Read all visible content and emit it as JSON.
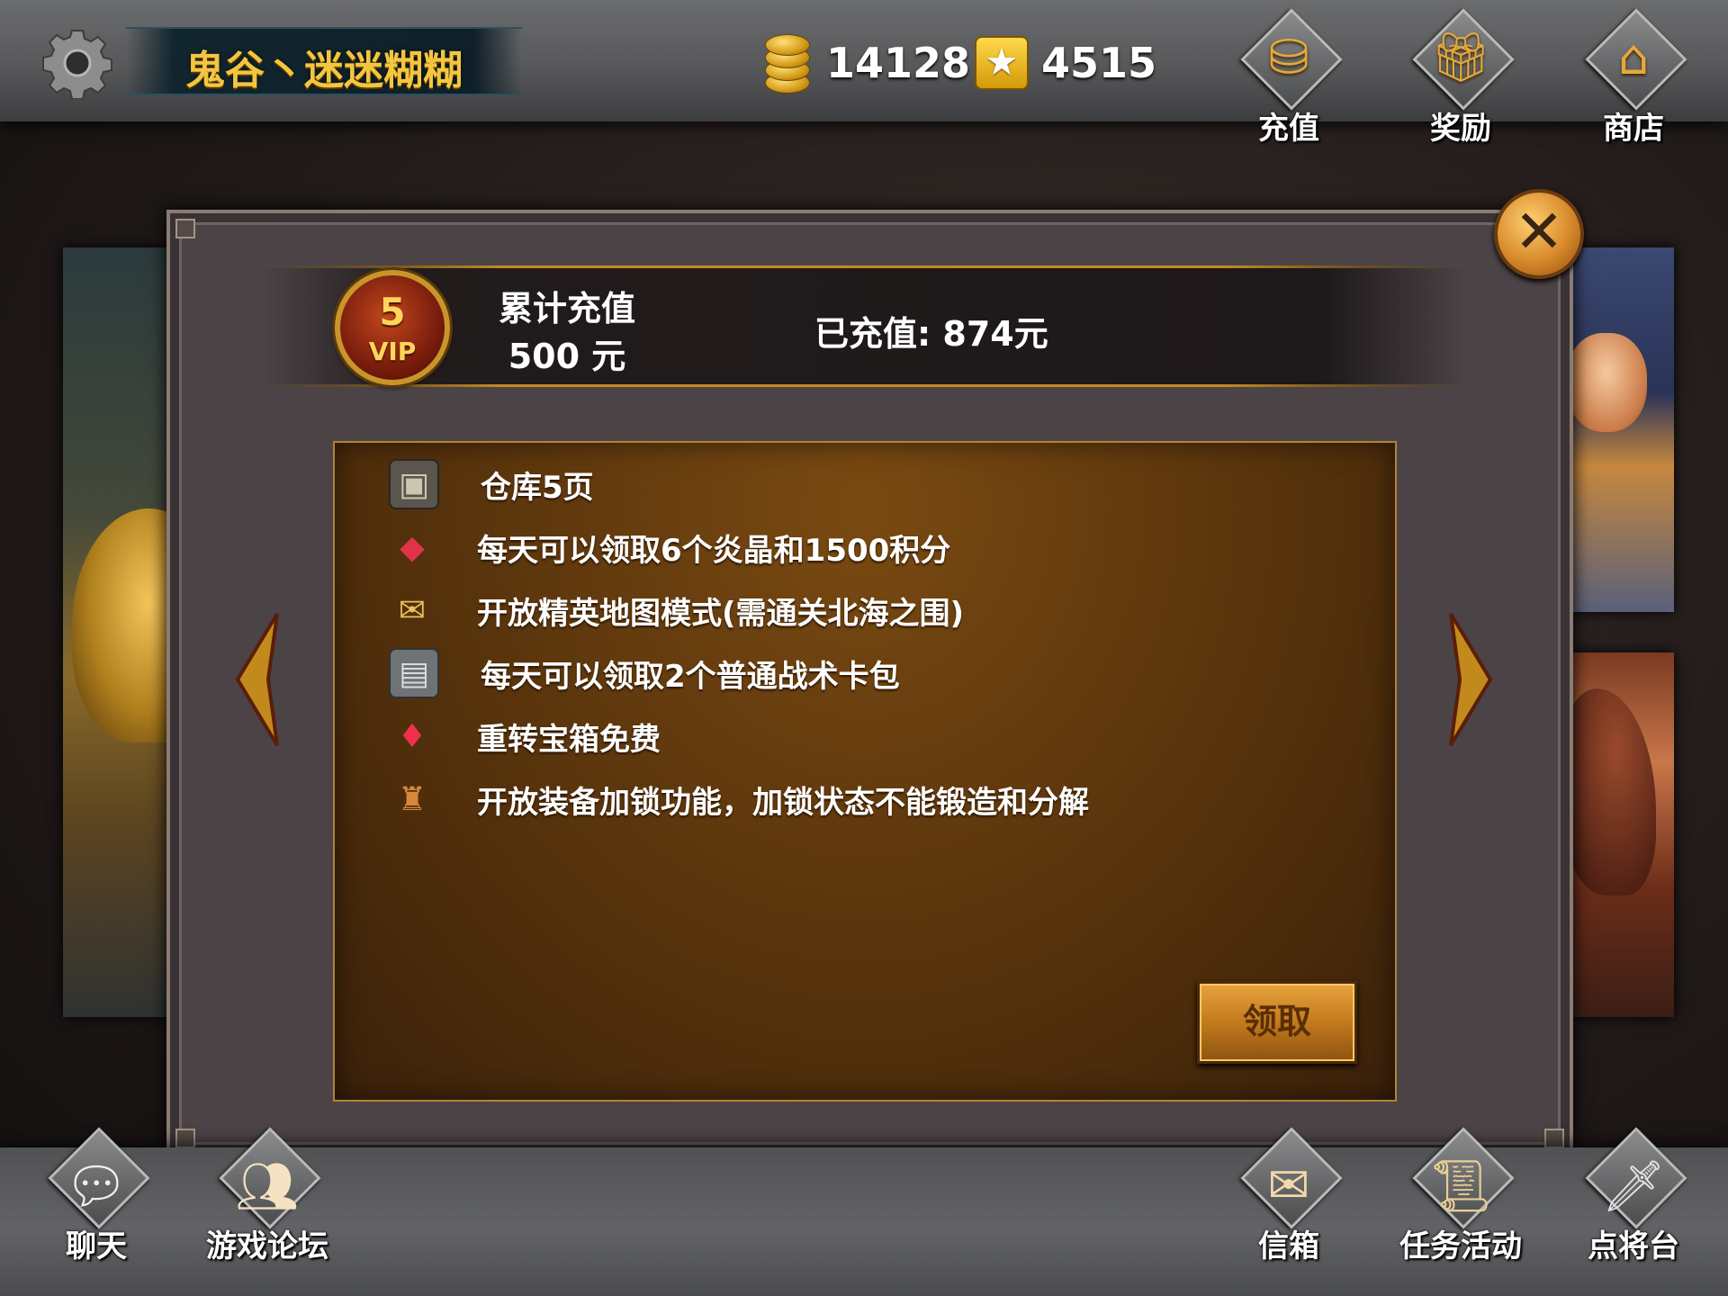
{
  "player": {
    "name": "鬼谷丶迷迷糊糊"
  },
  "currencies": {
    "gold": "14128",
    "stars": "4515"
  },
  "top_buttons": [
    {
      "label": "充值",
      "icon": "coin-basket-icon"
    },
    {
      "label": "奖励",
      "icon": "gift-box-icon"
    },
    {
      "label": "商店",
      "icon": "pavilion-shop-icon"
    }
  ],
  "vip_panel": {
    "level": "5",
    "badge_text": "VIP",
    "cumulative_label": "累计充值",
    "cumulative_amount": "500 元",
    "paid_status": "已充值: 874元"
  },
  "benefits": [
    {
      "icon": "chest-icon",
      "text": "仓库5页"
    },
    {
      "icon": "red-crystal-icon",
      "text": "每天可以领取6个炎晶和1500积分"
    },
    {
      "icon": "scroll-map-icon",
      "text": "开放精英地图模式(需通关北海之围)"
    },
    {
      "icon": "tactics-card-icon",
      "text": "每天可以领取2个普通战术卡包"
    },
    {
      "icon": "gem-lock-icon",
      "text": "重转宝箱免费"
    },
    {
      "icon": "armor-lock-icon",
      "text": "开放装备加锁功能，加锁状态不能锻造和分解"
    }
  ],
  "claim_button": {
    "label": "领取"
  },
  "bottom_buttons": [
    {
      "label": "聊天",
      "icon": "chat-bubble-icon"
    },
    {
      "label": "游戏论坛",
      "icon": "forum-users-icon"
    },
    {
      "label": "信箱",
      "icon": "envelope-icon"
    },
    {
      "label": "任务活动",
      "icon": "quest-scroll-icon"
    },
    {
      "label": "点将台",
      "icon": "general-sword-icon"
    }
  ],
  "colors": {
    "gold_text": "#f4c640",
    "panel_border": "#b48432",
    "claim_button": "#c27a1d"
  }
}
